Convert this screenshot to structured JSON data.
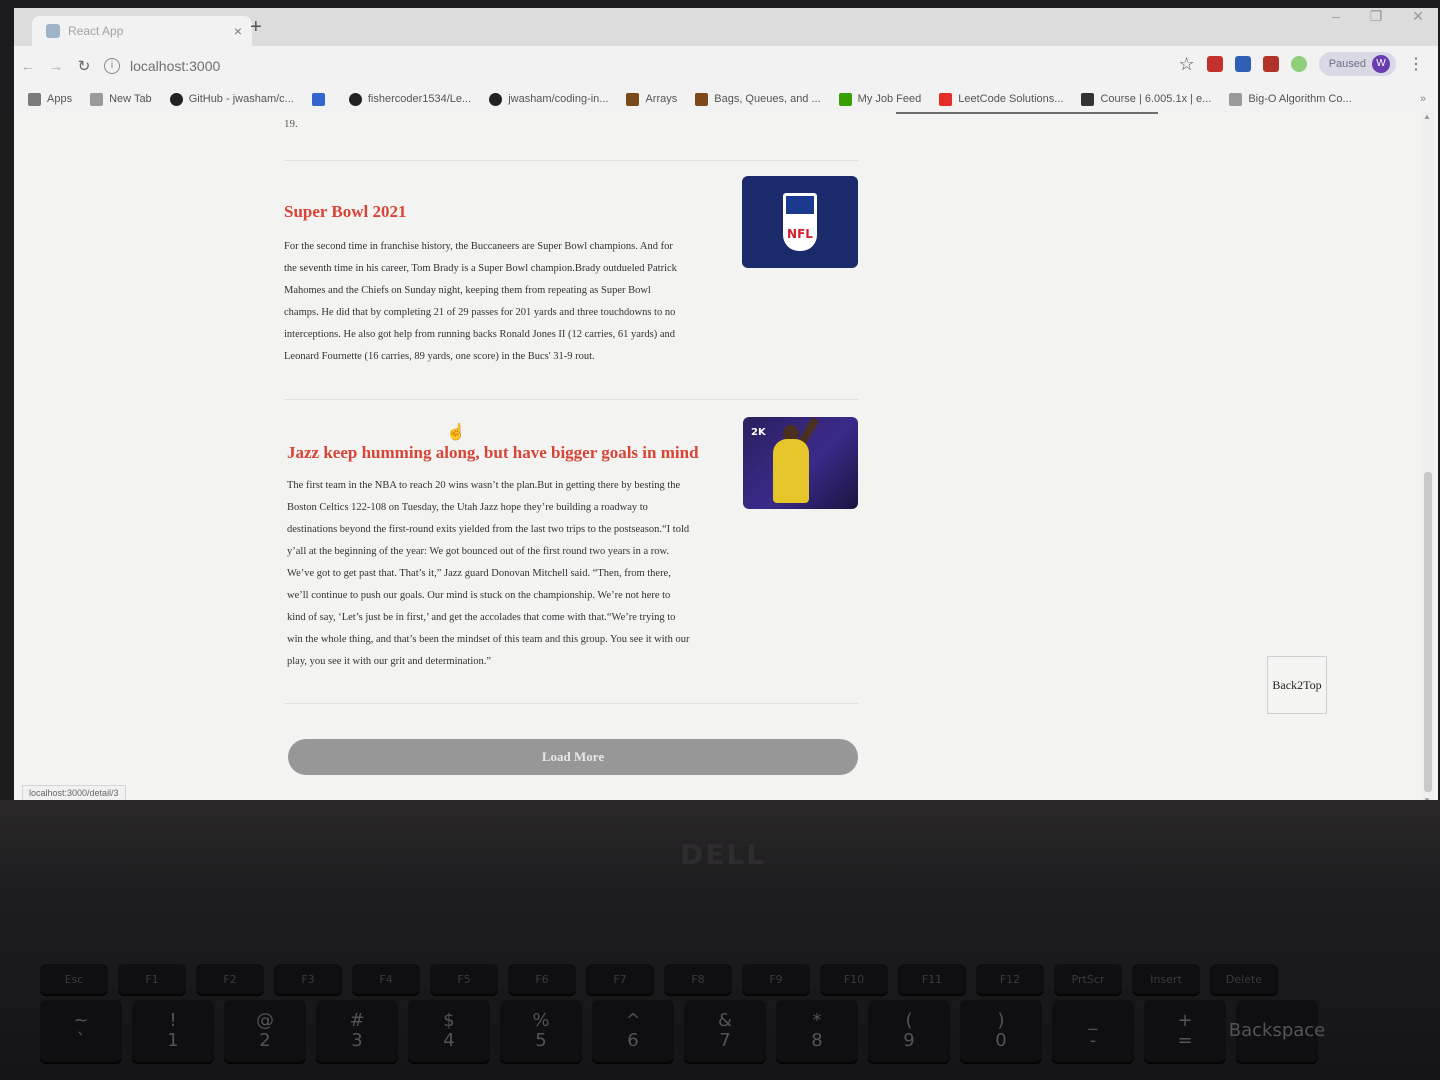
{
  "browser": {
    "tab_title": "React App",
    "tab_close": "×",
    "new_tab": "+",
    "window_controls": [
      "–",
      "❐",
      "✕"
    ],
    "url": "localhost:3000",
    "url_info": "i",
    "paused_label": "Paused",
    "avatar_letter": "W",
    "bookmarks": [
      {
        "label": "Apps",
        "icon": "apps-grid-icon",
        "color": "#7a7a7a"
      },
      {
        "label": "New Tab",
        "icon": "page-icon",
        "color": "#9a9a9a"
      },
      {
        "label": "GitHub - jwasham/c...",
        "icon": "github-icon",
        "color": "#222222"
      },
      {
        "label": "",
        "icon": "zhihu-icon",
        "color": "#3366cc"
      },
      {
        "label": "fishercoder1534/Le...",
        "icon": "github-icon",
        "color": "#222222"
      },
      {
        "label": "jwasham/coding-in...",
        "icon": "github-icon",
        "color": "#222222"
      },
      {
        "label": "Arrays",
        "icon": "princeton-icon",
        "color": "#7a4a1a"
      },
      {
        "label": "Bags, Queues, and ...",
        "icon": "princeton-icon",
        "color": "#7a4a1a"
      },
      {
        "label": "My Job Feed",
        "icon": "upwork-icon",
        "color": "#37a000"
      },
      {
        "label": "LeetCode Solutions...",
        "icon": "youtube-icon",
        "color": "#e52d27"
      },
      {
        "label": "Course | 6.005.1x | e...",
        "icon": "edx-icon",
        "color": "#333333"
      },
      {
        "label": "Big-O Algorithm Co...",
        "icon": "page-icon",
        "color": "#9a9a9a"
      }
    ],
    "bookmarks_more": "»",
    "status_url": "localhost:3000/detail/3"
  },
  "page": {
    "prev_tail": "19.",
    "articles": [
      {
        "title": "Super Bowl 2021",
        "image": "nfl-logo",
        "image_text": "NFL",
        "lines": [
          "For the second time in franchise history, the Buccaneers are Super Bowl champions. And for",
          "the seventh time in his career, Tom Brady is a Super Bowl champion.Brady outdueled Patrick",
          "Mahomes and the Chiefs on Sunday night, keeping them from repeating as Super Bowl",
          "champs. He did that by completing 21 of 29 passes for 201 yards and three touchdowns to no",
          "interceptions. He also got help from running backs Ronald Jones II (12 carries, 61 yards) and",
          "Leonard Fournette (16 carries, 89 yards, one score) in the Bucs' 31-9 rout."
        ]
      },
      {
        "title": "Jazz keep humming along, but have bigger goals in mind",
        "image": "basketball-player",
        "image_text": "2K",
        "lines": [
          "The first team in the NBA to reach 20 wins wasn’t the plan.But in getting there by besting the",
          "Boston Celtics 122-108 on Tuesday, the Utah Jazz hope they’re building a roadway to",
          "destinations beyond the first-round exits yielded from the last two trips to the postseason.“I told",
          "y’all at the beginning of the year: We got bounced out of the first round two years in a row.",
          "We’ve got to get past that. That’s it,” Jazz guard Donovan Mitchell said. “Then, from there,",
          "we’ll continue to push our goals. Our mind is stuck on the championship. We’re not here to",
          "kind of say, ‘Let’s just be in first,’ and get the accolades that come with that.“We’re trying to",
          "win the whole thing, and that’s been the mindset of this team and this group. You see it with our",
          "play, you see it with our grit and determination.”"
        ]
      }
    ],
    "load_more_label": "Load More",
    "back_to_top_label": "Back2Top"
  },
  "hardware": {
    "brand": "DELL",
    "fn_keys": [
      "Esc",
      "F1",
      "F2",
      "F3",
      "F4",
      "F5",
      "F6",
      "F7",
      "F8",
      "F9",
      "F10",
      "F11",
      "F12",
      "PrtScr",
      "Insert",
      "Delete"
    ],
    "num_keys": [
      {
        "top": "~",
        "bottom": "`"
      },
      {
        "top": "!",
        "bottom": "1"
      },
      {
        "top": "@",
        "bottom": "2"
      },
      {
        "top": "#",
        "bottom": "3"
      },
      {
        "top": "$",
        "bottom": "4"
      },
      {
        "top": "%",
        "bottom": "5"
      },
      {
        "top": "^",
        "bottom": "6"
      },
      {
        "top": "&",
        "bottom": "7"
      },
      {
        "top": "*",
        "bottom": "8"
      },
      {
        "top": "(",
        "bottom": "9"
      },
      {
        "top": ")",
        "bottom": "0"
      },
      {
        "top": "_",
        "bottom": "-"
      },
      {
        "top": "+",
        "bottom": "="
      },
      {
        "top": "",
        "bottom": "Backspace"
      }
    ]
  }
}
